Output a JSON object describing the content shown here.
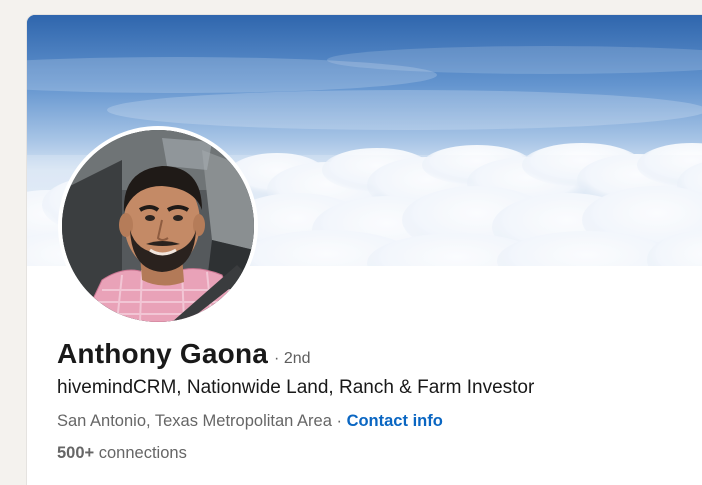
{
  "profile": {
    "name": "Anthony Gaona",
    "degree": "· 2nd",
    "headline": "hivemindCRM, Nationwide Land, Ranch & Farm Investor",
    "location": "San Antonio, Texas Metropolitan Area",
    "separator": " · ",
    "contact_info_label": "Contact info",
    "connections_count": "500+",
    "connections_label": " connections"
  },
  "colors": {
    "link": "#0a66c2",
    "name_text": "#191919",
    "secondary_text": "#666666",
    "page_background": "#f4f2ee"
  },
  "icons": {
    "cover": "sky-clouds-cover-image",
    "avatar": "profile-photo"
  }
}
